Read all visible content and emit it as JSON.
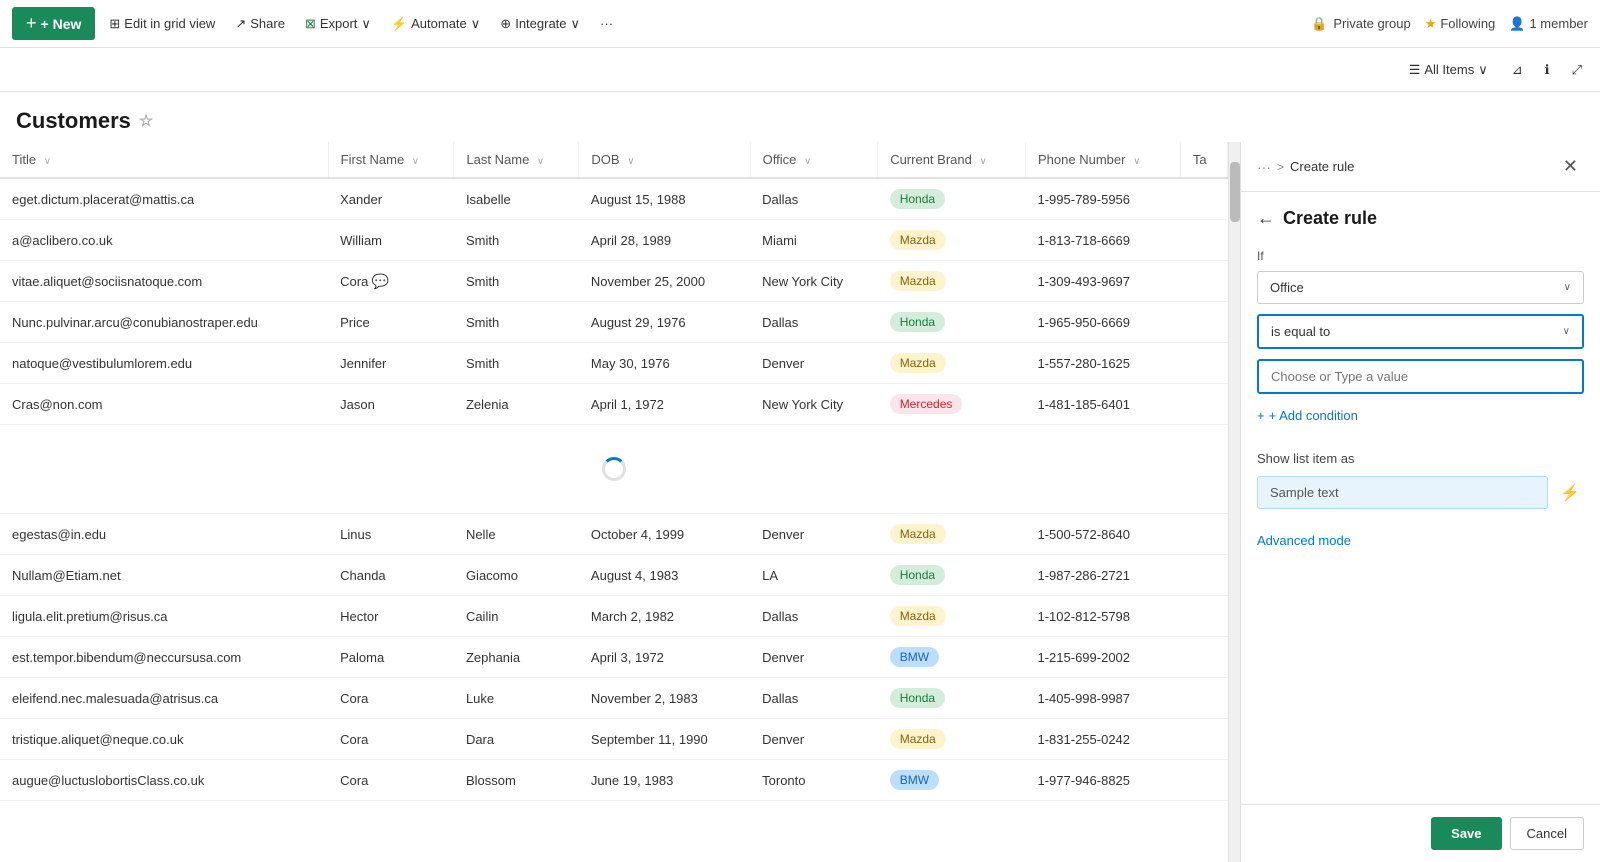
{
  "header": {
    "new_label": "+ New",
    "edit_grid_label": "Edit in grid view",
    "share_label": "Share",
    "export_label": "Export",
    "automate_label": "Automate",
    "integrate_label": "Integrate",
    "more_label": "···",
    "private_group_label": "Private group",
    "following_label": "Following",
    "member_label": "1 member",
    "all_items_label": "All Items"
  },
  "page": {
    "title": "Customers",
    "star_icon": "☆"
  },
  "table": {
    "columns": [
      {
        "id": "title",
        "label": "Title"
      },
      {
        "id": "first_name",
        "label": "First Name"
      },
      {
        "id": "last_name",
        "label": "Last Name"
      },
      {
        "id": "dob",
        "label": "DOB"
      },
      {
        "id": "office",
        "label": "Office"
      },
      {
        "id": "current_brand",
        "label": "Current Brand"
      },
      {
        "id": "phone_number",
        "label": "Phone Number"
      },
      {
        "id": "ta",
        "label": "Ta"
      }
    ],
    "rows": [
      {
        "title": "eget.dictum.placerat@mattis.ca",
        "first_name": "Xander",
        "last_name": "Isabelle",
        "dob": "August 15, 1988",
        "office": "Dallas",
        "brand": "Honda",
        "brand_class": "honda",
        "phone": "1-995-789-5956",
        "chat": false
      },
      {
        "title": "a@aclibero.co.uk",
        "first_name": "William",
        "last_name": "Smith",
        "dob": "April 28, 1989",
        "office": "Miami",
        "brand": "Mazda",
        "brand_class": "mazda",
        "phone": "1-813-718-6669",
        "chat": false
      },
      {
        "title": "vitae.aliquet@sociisnatoque.com",
        "first_name": "Cora",
        "last_name": "Smith",
        "dob": "November 25, 2000",
        "office": "New York City",
        "brand": "Mazda",
        "brand_class": "mazda",
        "phone": "1-309-493-9697",
        "chat": true
      },
      {
        "title": "Nunc.pulvinar.arcu@conubianostraper.edu",
        "first_name": "Price",
        "last_name": "Smith",
        "dob": "August 29, 1976",
        "office": "Dallas",
        "brand": "Honda",
        "brand_class": "honda",
        "phone": "1-965-950-6669",
        "chat": false
      },
      {
        "title": "natoque@vestibulumlorem.edu",
        "first_name": "Jennifer",
        "last_name": "Smith",
        "dob": "May 30, 1976",
        "office": "Denver",
        "brand": "Mazda",
        "brand_class": "mazda",
        "phone": "1-557-280-1625",
        "chat": false
      },
      {
        "title": "Cras@non.com",
        "first_name": "Jason",
        "last_name": "Zelenia",
        "dob": "April 1, 1972",
        "office": "New York City",
        "brand": "Mercedes",
        "brand_class": "mercedes",
        "phone": "1-481-185-6401",
        "chat": false
      },
      {
        "title": "",
        "first_name": "",
        "last_name": "",
        "dob": "",
        "office": "",
        "brand": "",
        "brand_class": "",
        "phone": "",
        "chat": false
      },
      {
        "title": "egestas@in.edu",
        "first_name": "Linus",
        "last_name": "Nelle",
        "dob": "October 4, 1999",
        "office": "Denver",
        "brand": "Mazda",
        "brand_class": "mazda",
        "phone": "1-500-572-8640",
        "chat": false
      },
      {
        "title": "Nullam@Etiam.net",
        "first_name": "Chanda",
        "last_name": "Giacomo",
        "dob": "August 4, 1983",
        "office": "LA",
        "brand": "Honda",
        "brand_class": "honda",
        "phone": "1-987-286-2721",
        "chat": false
      },
      {
        "title": "ligula.elit.pretium@risus.ca",
        "first_name": "Hector",
        "last_name": "Cailin",
        "dob": "March 2, 1982",
        "office": "Dallas",
        "brand": "Mazda",
        "brand_class": "mazda",
        "phone": "1-102-812-5798",
        "chat": false
      },
      {
        "title": "est.tempor.bibendum@neccursusa.com",
        "first_name": "Paloma",
        "last_name": "Zephania",
        "dob": "April 3, 1972",
        "office": "Denver",
        "brand": "BMW",
        "brand_class": "bmw",
        "phone": "1-215-699-2002",
        "chat": false
      },
      {
        "title": "eleifend.nec.malesuada@atrisus.ca",
        "first_name": "Cora",
        "last_name": "Luke",
        "dob": "November 2, 1983",
        "office": "Dallas",
        "brand": "Honda",
        "brand_class": "honda",
        "phone": "1-405-998-9987",
        "chat": false
      },
      {
        "title": "tristique.aliquet@neque.co.uk",
        "first_name": "Cora",
        "last_name": "Dara",
        "dob": "September 11, 1990",
        "office": "Denver",
        "brand": "Mazda",
        "brand_class": "mazda",
        "phone": "1-831-255-0242",
        "chat": false
      },
      {
        "title": "augue@luctuslobortisClass.co.uk",
        "first_name": "Cora",
        "last_name": "Blossom",
        "dob": "June 19, 1983",
        "office": "Toronto",
        "brand": "BMW",
        "brand_class": "bmw",
        "phone": "1-977-946-8825",
        "chat": false
      }
    ]
  },
  "panel": {
    "breadcrumb_dots": "···",
    "breadcrumb_sep": ">",
    "breadcrumb_current": "Create rule",
    "back_icon": "←",
    "title": "Create rule",
    "if_label": "If",
    "field_value": "Office",
    "condition_value": "is equal to",
    "value_placeholder": "Choose or Type a value",
    "add_condition_label": "+ Add condition",
    "show_as_label": "Show list item as",
    "sample_text_label": "Sample text",
    "advanced_mode_label": "Advanced mode",
    "save_label": "Save",
    "cancel_label": "Cancel"
  }
}
